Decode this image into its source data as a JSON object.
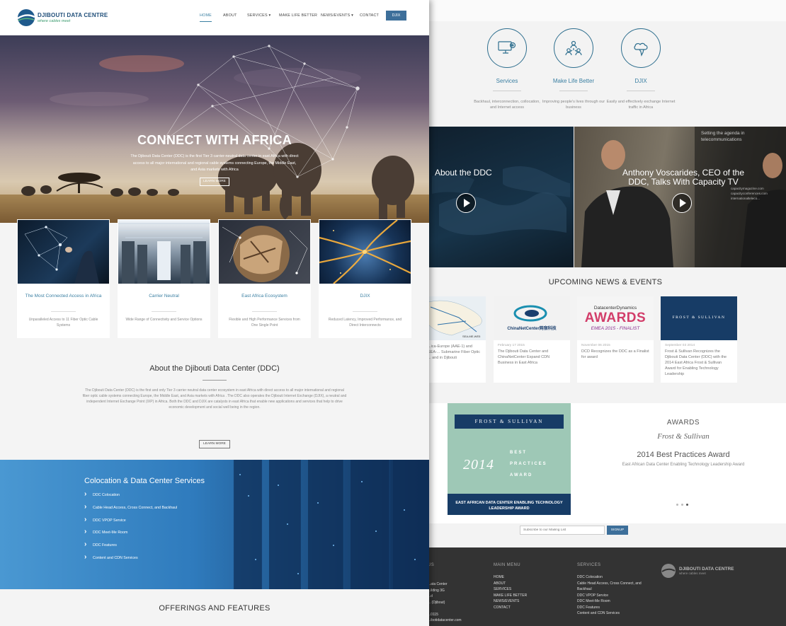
{
  "site": {
    "logo_name": "DJIBOUTI DATA CENTRE",
    "logo_tagline": "where cables meet"
  },
  "nav": {
    "items": [
      "HOME",
      "ABOUT",
      "SERVICES",
      "MAKE LIFE BETTER",
      "NEWS/EVENTS",
      "CONTACT"
    ],
    "dropdown_marker": "▾",
    "button": "DJIX"
  },
  "hero": {
    "title": "CONNECT WITH AFRICA",
    "text": "The Djibouti Data Center (DDC) is the first Tier 3 carrier-neutral data center in east Africa with direct access to all major international and regional cable systems connecting Europe, the Middle East, and Asia markets with Africa",
    "button": "LEARN MORE"
  },
  "cards": [
    {
      "title": "The Most Connected Access in Africa",
      "desc": "Unparalleled Access to 11 Fiber Optic Cable Systems"
    },
    {
      "title": "Carrier Neutral",
      "desc": "Wide Range of Connectivity and Service Options"
    },
    {
      "title": "East Africa Ecosystem",
      "desc": "Flexible and High Performance Services from One Single Point"
    },
    {
      "title": "DJIX",
      "desc": "Reduced Latency, Improved Performance, and Direct Interconnects"
    }
  ],
  "about": {
    "title": "About the Djibouti Data Center (DDC)",
    "text": "The Djibouti Data Center (DDC) is the first and only Tier 3 carrier neutral data center ecosystem in east Africa with direct access to all major international and regional fiber optic cable systems connecting Europe, the Middle East, and Asia markets with Africa .  The DDC also operates the Djibouti Internet Exchange (DJIX), a neutral and independent Internet Exchange Point (IXP) in Africa.  Both the DDC and DJIX are catalysts in east Africa that enable new applications and services that help to drive economic development and social well being in the region.",
    "button": "LEARN MORE"
  },
  "colocation": {
    "title": "Colocation & Data Center Services",
    "items": [
      "DDC Colocation",
      "Cable Head Access, Cross Connect, and Backhaul",
      "DDC VPOP Service",
      "DDC Meet-Me Room",
      "DDC Features",
      "Content and CDN Services"
    ]
  },
  "offerings": {
    "title": "OFFERINGS AND FEATURES"
  },
  "features": [
    {
      "title": "Services",
      "desc": "Backhaul, interconnection, collocation, and Internet access"
    },
    {
      "title": "Make Life Better",
      "desc": "Improving people's lives through our business"
    },
    {
      "title": "DJIX",
      "desc": "Easily and effectively exchange Internet traffic in Africa"
    }
  ],
  "videos": [
    {
      "title": "About the DDC"
    },
    {
      "title": "Anthony Voscarides, CEO of the DDC, Talks With Capacity TV",
      "overlay": "Setting the agenda in telecommunications",
      "site_lines": [
        "capacitymagazine.com",
        "capacityconferences.com",
        "internationalteleco..."
      ]
    }
  ],
  "news": {
    "title": "UPCOMING NEWS & EVENTS",
    "items": [
      {
        "date": "",
        "text": "...ica-Europe (AAE-1) and SEA-... Submarine Fiber Optic ... and in Djibouti",
        "img_label": "SEA-ME-WE5"
      },
      {
        "date": "February 17 2015",
        "text": "The Djibouti Data Center and ChinaNetCenter Expand CDN Business in East Africa",
        "img_label": "ChinaNetCenter网宿科技"
      },
      {
        "date": "November 06 2015",
        "text": "DCD Recognizes the DDC as a Finalist for award",
        "img_top": "DatacenterDynamics",
        "img_main": "AWARDS",
        "img_sub": "EMEA 2015 - FINALIST"
      },
      {
        "date": "September 03 2014",
        "text": "Frost & Sullivan Recognizes the Djibouti Data Center (DDC) with the 2014 East Africa Frost & Sullivan Award for Enabling Technology Leadership",
        "img_label": "FROST & SULLIVAN"
      }
    ]
  },
  "awards": {
    "badge_top": "FROST & SULLIVAN",
    "badge_year": "2014",
    "badge_text": [
      "BEST",
      "PRACTICES",
      "AWARD"
    ],
    "badge_bottom": "EAST AFRICAN DATA CENTER ENABLING TECHNOLOGY LEADERSHIP AWARD",
    "title": "AWARDS",
    "sub": "Frost & Sullivan",
    "name": "2014 Best Practices Award",
    "desc": "East African Data Center Enabling Technology Leadership Award"
  },
  "subscribe": {
    "placeholder": "Subscribe to our Mailing List",
    "button": "SIGNUP"
  },
  "footer": {
    "col1_title": "US",
    "col1": [
      "...ata Center",
      "...ilding 3G",
      "...d",
      "... (Djibout)",
      "",
      "...0115",
      "...ibotidatacenter.com"
    ],
    "col2_title": "MAIN MENU",
    "col2": [
      "HOME",
      "ABOUT",
      "SERVICES",
      "MAKE LIFE BETTER",
      "NEWS/EVENTS",
      "CONTACT"
    ],
    "col3_title": "SERVICES",
    "col3": [
      "DDC Colocation",
      "Cable Head Access, Cross Connect, and",
      "Backhaul",
      "DDC VPOP Service",
      "DDC Meet-Me Room",
      "DDC Features",
      "Content and CDN Services"
    ],
    "logo_name": "DJIBOUTI DATA CENTRE",
    "logo_tagline": "where cables meet"
  }
}
